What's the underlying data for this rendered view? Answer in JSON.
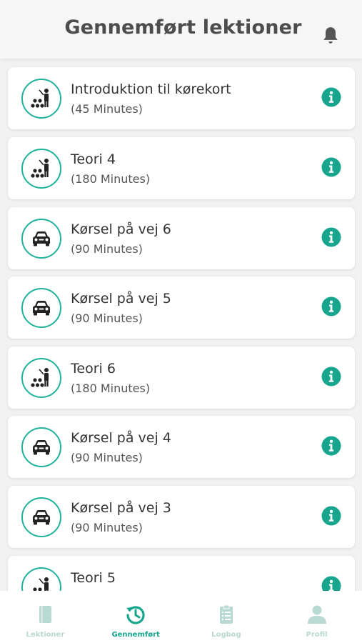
{
  "header": {
    "title": "Gennemført lektioner",
    "bell_icon": "bell-icon"
  },
  "lessons": [
    {
      "title": "Introduktion til kørekort",
      "duration": "(45 Minutes)",
      "icon": "classroom-icon"
    },
    {
      "title": "Teori 4",
      "duration": "(180 Minutes)",
      "icon": "classroom-icon"
    },
    {
      "title": "Kørsel på vej 6",
      "duration": "(90 Minutes)",
      "icon": "car-icon"
    },
    {
      "title": "Kørsel på vej 5",
      "duration": "(90 Minutes)",
      "icon": "car-icon"
    },
    {
      "title": "Teori 6",
      "duration": "(180 Minutes)",
      "icon": "classroom-icon"
    },
    {
      "title": "Kørsel på vej 4",
      "duration": "(90 Minutes)",
      "icon": "car-icon"
    },
    {
      "title": "Kørsel på vej 3",
      "duration": "(90 Minutes)",
      "icon": "car-icon"
    },
    {
      "title": "Teori 5",
      "duration": "",
      "icon": "classroom-icon"
    }
  ],
  "tabs": [
    {
      "label": "Lektioner",
      "icon": "book-icon",
      "active": false
    },
    {
      "label": "Gennemført",
      "icon": "history-icon",
      "active": true
    },
    {
      "label": "Logbog",
      "icon": "clipboard-icon",
      "active": false
    },
    {
      "label": "Profil",
      "icon": "user-icon",
      "active": false
    }
  ],
  "colors": {
    "accent": "#17a58d",
    "accent_light": "#b9d9d3",
    "icon_dark": "#222222"
  }
}
